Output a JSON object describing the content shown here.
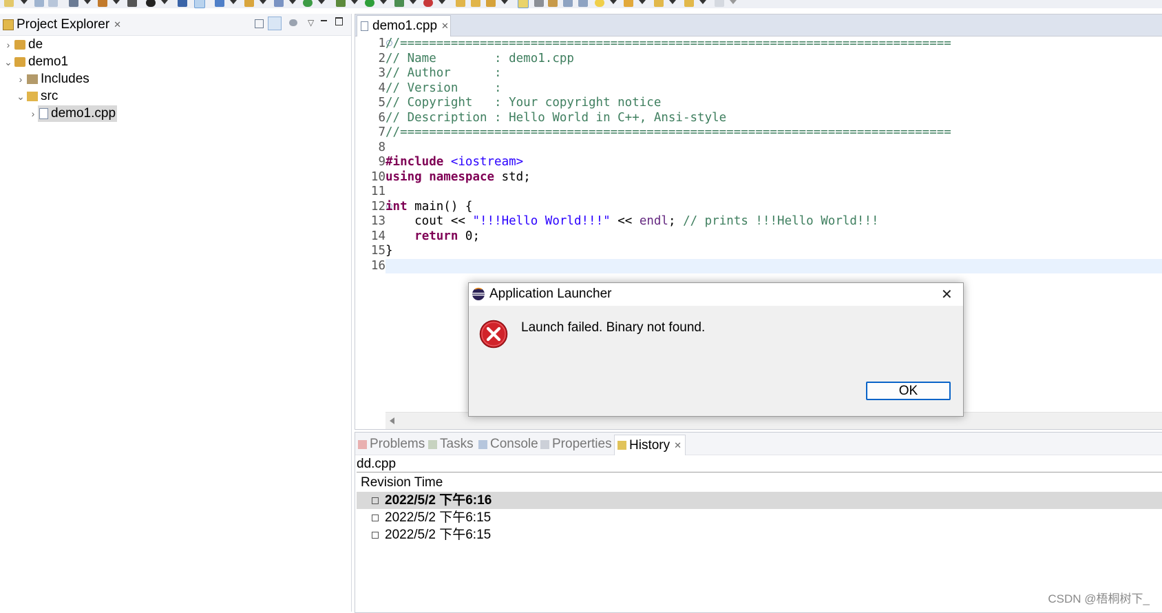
{
  "toolbar": {
    "icons": [
      "new-icon",
      "save-icon",
      "save-all-icon",
      "settings-icon",
      "build-icon",
      "binary-icon",
      "debug-user-icon",
      "monitor-icon",
      "search-icon",
      "new-class-icon",
      "folder-icon",
      "c-file-icon",
      "refresh-icon",
      "gear-bug-icon",
      "run-icon",
      "run-config-icon",
      "external-tool-icon",
      "open-folder-icon",
      "open-file-icon",
      "pin-icon",
      "edit-icon",
      "key-icon",
      "clipboard-icon",
      "list-icon",
      "lightbulb-icon",
      "up-arrow-icon",
      "back-icon",
      "forward-icon",
      "next-icon"
    ]
  },
  "explorer": {
    "title": "Project Explorer",
    "tree": [
      {
        "label": "de",
        "expanded": false
      },
      {
        "label": "demo1",
        "expanded": true
      },
      {
        "label": "Includes",
        "expanded": false
      },
      {
        "label": "src",
        "expanded": true
      },
      {
        "label": "demo1.cpp",
        "expanded": false,
        "selected": true
      }
    ]
  },
  "editor": {
    "tab_title": "demo1.cpp",
    "line_numbers": [
      "1",
      "2",
      "3",
      "4",
      "5",
      "6",
      "7",
      "8",
      "9",
      "10",
      "11",
      "12",
      "13",
      "14",
      "15",
      "16"
    ],
    "code": {
      "l1": "//============================================================================",
      "l2": "// Name        : demo1.cpp",
      "l3": "// Author      :",
      "l4": "// Version     :",
      "l5": "// Copyright   : Your copyright notice",
      "l6": "// Description : Hello World in C++, Ansi-style",
      "l7": "//============================================================================",
      "l9_kw": "#include",
      "l9_inc": "<iostream>",
      "l10_kw1": "using",
      "l10_kw2": "namespace",
      "l10_rest": "std;",
      "l12_kw": "int",
      "l12_rest": "main() {",
      "l13_a": "    cout <<",
      "l13_str": "\"!!!Hello World!!!\"",
      "l13_b": "<<",
      "l13_endl": "endl",
      "l13_c": ";",
      "l13_comment": "// prints !!!Hello World!!!",
      "l14_indent": "    ",
      "l14_kw": "return",
      "l14_rest": "0;",
      "l15": "}"
    }
  },
  "bottom": {
    "tabs": [
      "Problems",
      "Tasks",
      "Console",
      "Properties",
      "History"
    ],
    "active_tab": "History",
    "file": "dd.cpp",
    "column_header": "Revision Time",
    "rows": [
      {
        "time": "2022/5/2 下午6:16",
        "current": true
      },
      {
        "time": "2022/5/2 下午6:15",
        "current": false
      },
      {
        "time": "2022/5/2 下午6:15",
        "current": false
      }
    ]
  },
  "dialog": {
    "title": "Application Launcher",
    "message": "Launch failed. Binary not found.",
    "ok_label": "OK"
  },
  "watermark": "CSDN @梧桐树下_",
  "colors": {
    "comment": "#3f7f5f",
    "keyword": "#7f0055",
    "string": "#2a00ff",
    "error": "#d1232a",
    "button_border": "#0a64c8"
  }
}
